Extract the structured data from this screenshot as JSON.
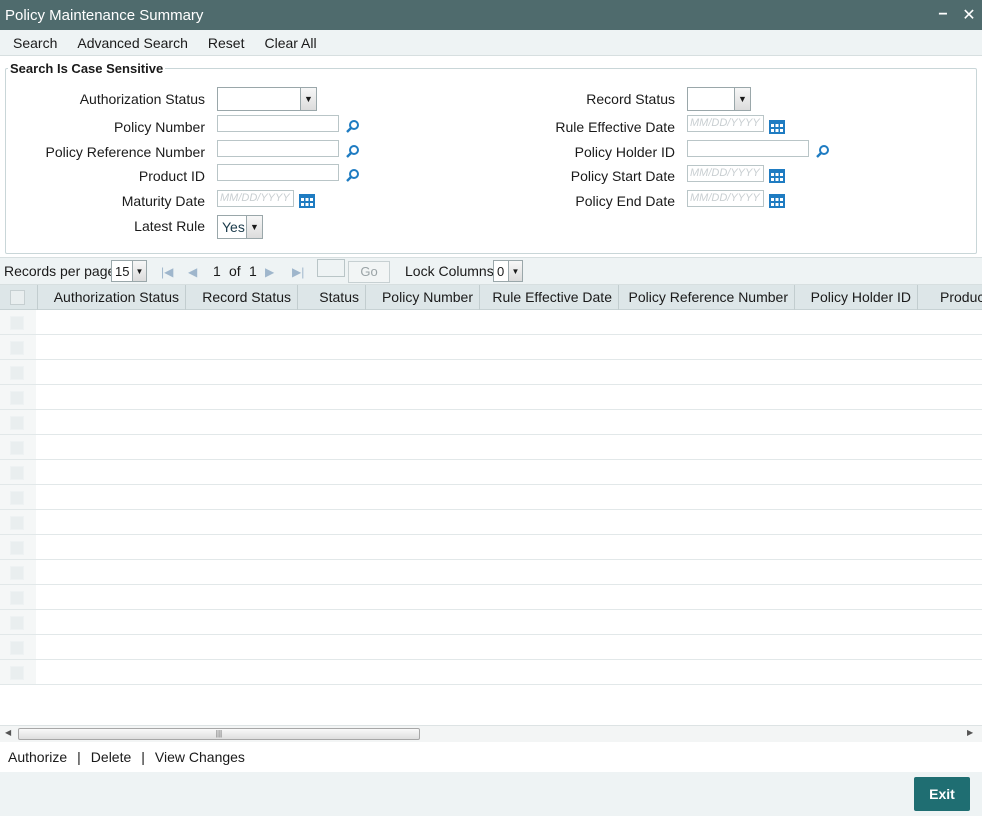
{
  "window": {
    "title": "Policy Maintenance Summary",
    "minimize": "−",
    "close": "✕"
  },
  "menu": {
    "items": [
      "Search",
      "Advanced Search",
      "Reset",
      "Clear All"
    ]
  },
  "search": {
    "legend": "Search Is Case Sensitive",
    "left_fields": {
      "authorization_status": "Authorization Status",
      "policy_number": "Policy Number",
      "policy_reference_number": "Policy Reference Number",
      "product_id": "Product ID",
      "maturity_date": "Maturity Date",
      "latest_rule": "Latest Rule"
    },
    "right_fields": {
      "record_status": "Record Status",
      "rule_effective_date": "Rule Effective Date",
      "policy_holder_id": "Policy Holder ID",
      "policy_start_date": "Policy Start Date",
      "policy_end_date": "Policy End Date"
    },
    "date_placeholder": "MM/DD/YYYY",
    "latest_rule_value": "Yes"
  },
  "pager": {
    "records_per_page_label": "Records per page",
    "records_per_page": "15",
    "current_page": "1",
    "of_label": "of",
    "total_pages": "1",
    "go_label": "Go",
    "lock_columns_label": "Lock Columns",
    "lock_columns": "0"
  },
  "grid": {
    "columns": [
      "Authorization Status",
      "Record Status",
      "Status",
      "Policy Number",
      "Rule Effective Date",
      "Policy Reference Number",
      "Policy Holder ID",
      "Product"
    ],
    "row_count": 15
  },
  "actions": {
    "authorize": "Authorize",
    "delete": "Delete",
    "view_changes": "View Changes",
    "separator": "|"
  },
  "footer": {
    "exit": "Exit"
  },
  "colors": {
    "titlebar": "#4f6b6d",
    "accent": "#1f6e72",
    "icon": "#1f7cc2"
  }
}
